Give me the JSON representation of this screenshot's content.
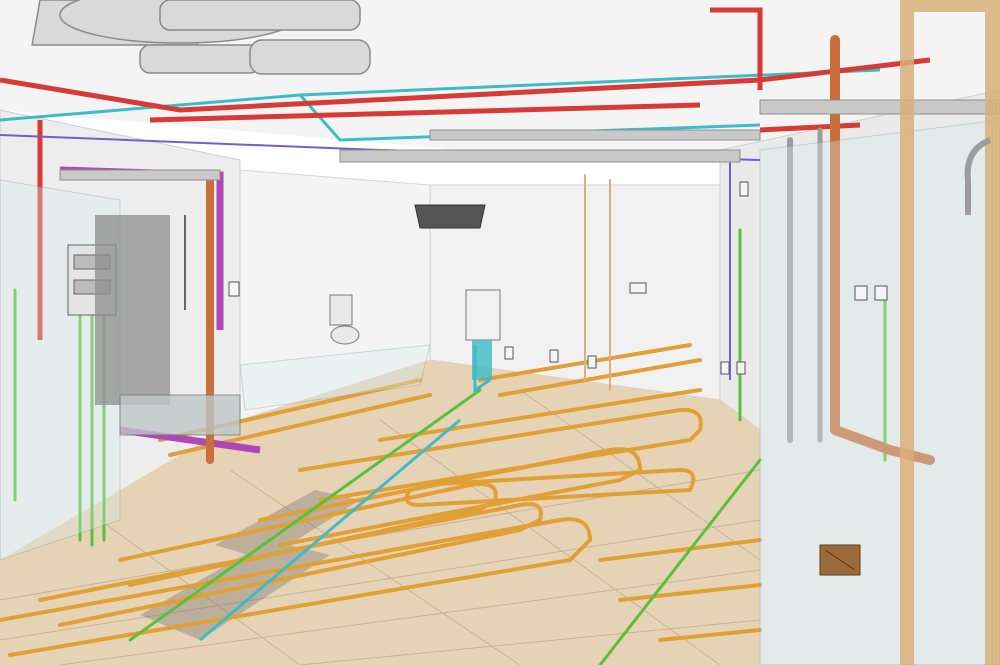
{
  "scene": {
    "kind": "bim-mep-cutaway-interior",
    "colors": {
      "floor": "#e6d3b6",
      "floor_grid": "#b9a68a",
      "wall": "#eeeeee",
      "ceiling": "#f4f4f4",
      "floor_heating_pipe": "#e0a035",
      "water_supply_pipe": "#5bbf3a",
      "drain_pipe_vertical": "#c86f3b",
      "hot_pipe": "#d83a35",
      "cold_pipe": "#3dbcc8",
      "gas_pipe": "#b146b8",
      "conduit_purple": "#7a5bc9",
      "duct_gray": "#9c9c9c",
      "frame_wood": "#d9b07a",
      "shadow": "#6e6e6e"
    },
    "icons": [
      "ceiling-cassette-ac-icon",
      "electrical-panel-icon",
      "water-heater-icon",
      "shower-icon",
      "toilet-icon",
      "outlet-icon",
      "floor-drain-icon"
    ]
  }
}
